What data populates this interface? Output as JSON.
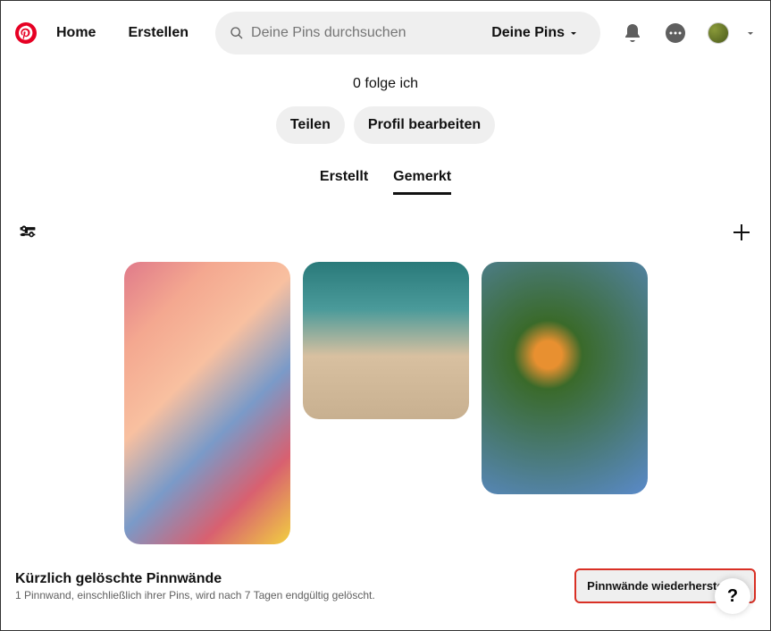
{
  "header": {
    "nav_home": "Home",
    "nav_create": "Erstellen",
    "search_placeholder": "Deine Pins durchsuchen",
    "search_filter": "Deine Pins"
  },
  "profile": {
    "stats": "0 folge ich",
    "share_btn": "Teilen",
    "edit_btn": "Profil bearbeiten"
  },
  "tabs": {
    "created": "Erstellt",
    "saved": "Gemerkt"
  },
  "deleted": {
    "title": "Kürzlich gelöschte Pinnwände",
    "subtitle": "1 Pinnwand, einschließlich ihrer Pins, wird nach 7 Tagen endgültig gelöscht.",
    "restore_btn": "Pinnwände wiederherstellen"
  },
  "help": {
    "label": "?"
  }
}
